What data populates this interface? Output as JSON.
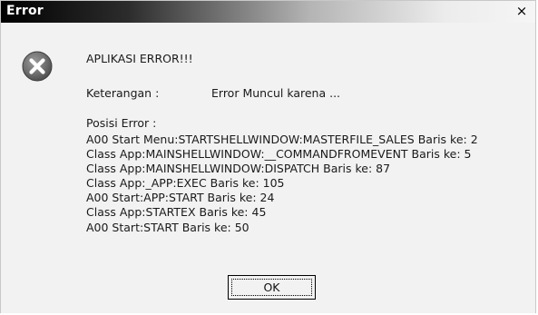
{
  "window": {
    "title": "Error",
    "close_glyph": "×"
  },
  "icon": {
    "name": "error-x-icon",
    "color": "#6b6b6b"
  },
  "message": {
    "heading": "APLIKASI ERROR!!!",
    "keterangan_label": "Keterangan :",
    "keterangan_value": "Error Muncul karena ...",
    "posisi_label": "Posisi Error :",
    "lines": [
      "A00  Start Menu:STARTSHELLWINDOW:MASTERFILE_SALES Baris ke: 2",
      "Class  App:MAINSHELLWINDOW:__COMMANDFROMEVENT Baris ke: 5",
      "Class  App:MAINSHELLWINDOW:DISPATCH Baris ke: 87",
      "Class  App:_APP:EXEC Baris ke: 105",
      "A00  Start:APP:START Baris ke: 24",
      "Class  App:STARTEX Baris ke: 45",
      "A00  Start:START Baris ke: 50"
    ]
  },
  "buttons": {
    "ok_label": "OK"
  }
}
